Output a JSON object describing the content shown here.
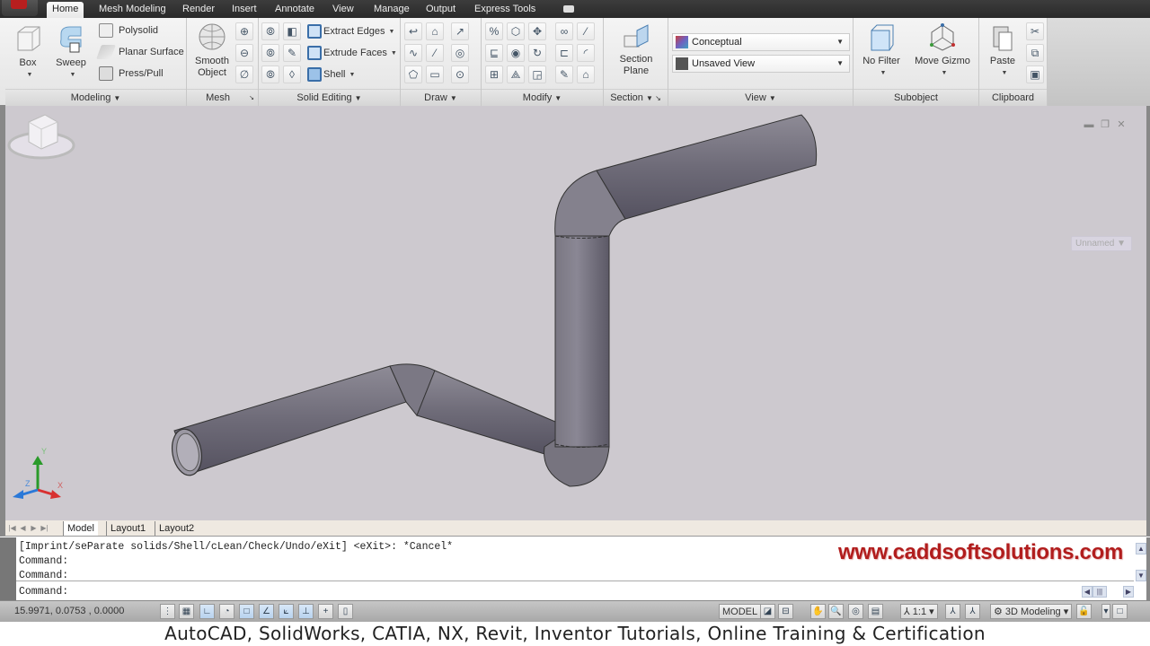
{
  "ribbon_tabs": [
    "Home",
    "Mesh Modeling",
    "Render",
    "Insert",
    "Annotate",
    "View",
    "Manage",
    "Output",
    "Express Tools"
  ],
  "active_tab": "Home",
  "panels": {
    "modeling": {
      "title": "Modeling",
      "big_buttons": [
        "Box",
        "Sweep"
      ],
      "small_buttons": [
        "Polysolid",
        "Planar Surface",
        "Press/Pull"
      ]
    },
    "mesh": {
      "title": "Mesh",
      "big_button": "Smooth Object",
      "big_button_line1": "Smooth",
      "big_button_line2": "Object"
    },
    "solid_editing": {
      "title": "Solid Editing",
      "small_buttons": [
        "Extract Edges",
        "Extrude Faces",
        "Shell"
      ]
    },
    "draw": {
      "title": "Draw"
    },
    "modify": {
      "title": "Modify"
    },
    "section": {
      "title": "Section",
      "big_button_line1": "Section",
      "big_button_line2": "Plane"
    },
    "view": {
      "title": "View",
      "visual_style": "Conceptual",
      "named_view": "Unsaved View"
    },
    "subobject": {
      "title": "Subobject",
      "buttons": [
        "No Filter",
        "Move Gizmo"
      ]
    },
    "clipboard": {
      "title": "Clipboard",
      "big_button": "Paste"
    }
  },
  "viewport": {
    "viewcube_label": "Unnamed",
    "ucs_axes": [
      "X",
      "Y",
      "Z"
    ],
    "controls": [
      "minimize",
      "restore",
      "close"
    ]
  },
  "layout_tabs": [
    "Model",
    "Layout1",
    "Layout2"
  ],
  "active_layout": "Model",
  "command": {
    "history": [
      "[Imprint/seParate solids/Shell/cLean/Check/Undo/eXit] <eXit>: *Cancel*",
      "Command:",
      "Command:"
    ],
    "prompt": "Command:",
    "watermark": "www.caddsoftsolutions.com"
  },
  "statusbar": {
    "coordinates": "15.9971, 0.0753 , 0.0000",
    "model_label": "MODEL",
    "annotation_scale": "1:1",
    "workspace": "3D Modeling"
  },
  "caption": "AutoCAD, SolidWorks, CATIA, NX, Revit, Inventor Tutorials, Online Training & Certification"
}
